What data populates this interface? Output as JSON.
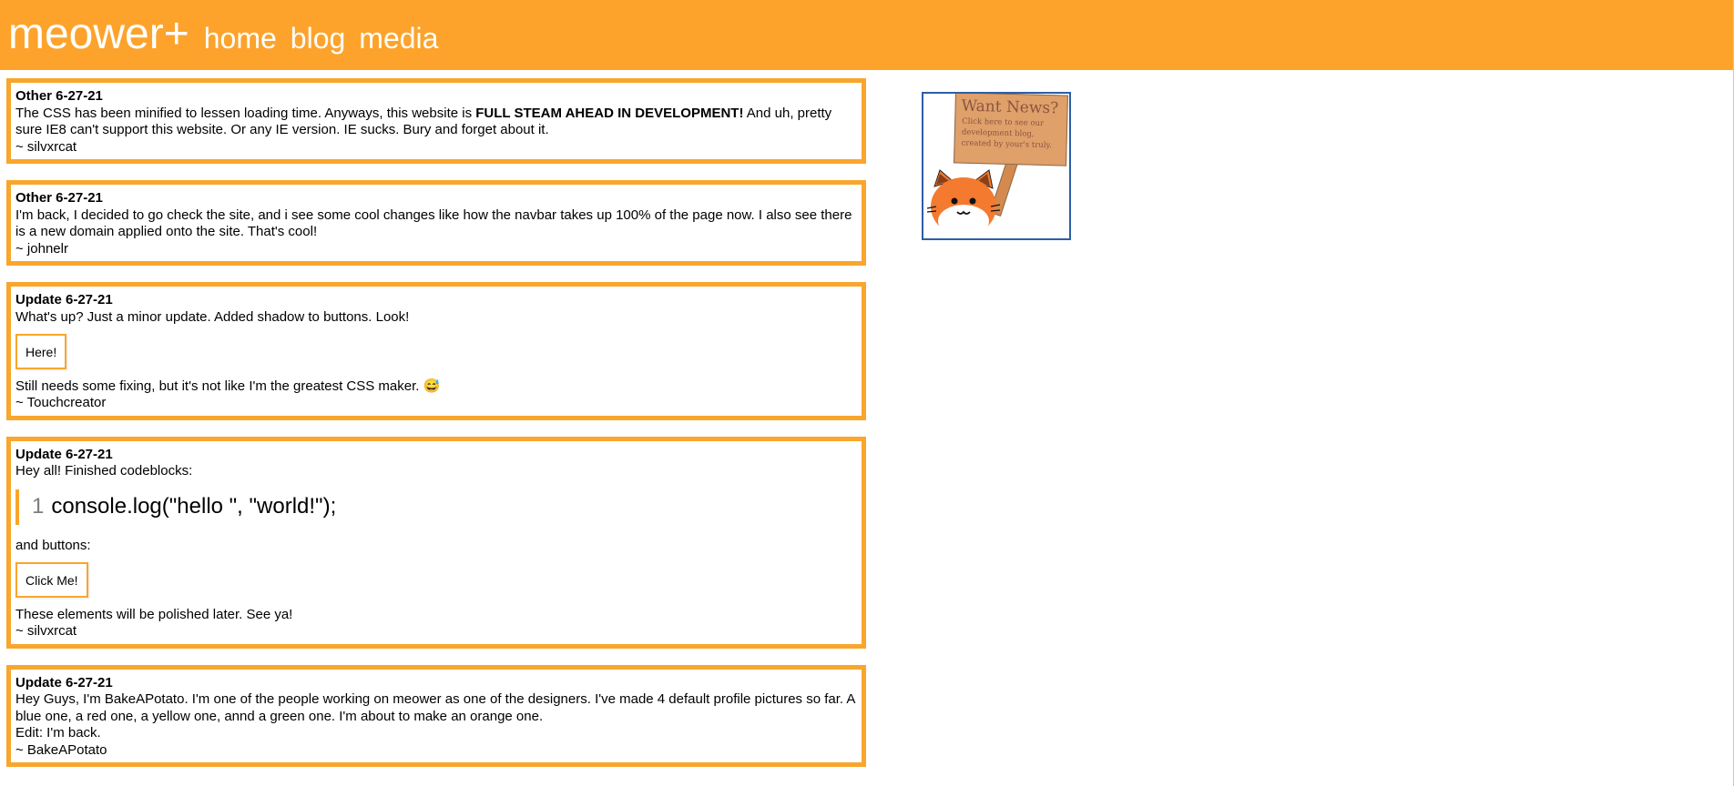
{
  "navbar": {
    "brand": "meower+",
    "links": [
      "home",
      "blog",
      "media"
    ],
    "color": "#fda32b"
  },
  "posts": [
    {
      "title": "Other 6-27-21",
      "text_before_bold": "The CSS has been minified to lessen loading time. Anyways, this website is ",
      "text_bold": "FULL STEAM AHEAD IN DEVELOPMENT!",
      "text_after_bold": " And uh, pretty sure IE8 can't support this website. Or any IE version. IE sucks. Bury and forget about it.",
      "signature": "~ silvxrcat"
    },
    {
      "title": "Other 6-27-21",
      "text": "I'm back, I decided to go check the site, and i see some cool changes like how the navbar takes up 100% of the page now. I also see there is a new domain applied onto the site. That's cool!",
      "signature": "~ johnelr"
    },
    {
      "title": "Update 6-27-21",
      "text": "What's up? Just a minor update. Added shadow to buttons. Look!",
      "button_label": "Here!",
      "text2": "Still needs some fixing, but it's not like I'm the greatest CSS maker. 😅",
      "signature": "~ Touchcreator"
    },
    {
      "title": "Update 6-27-21",
      "text": "Hey all! Finished codeblocks:",
      "code_line_number": "1",
      "code": "console.log(\"hello \", \"world!\");",
      "text2": "and buttons:",
      "button_label": "Click Me!",
      "text3": "These elements will be polished later. See ya!",
      "signature": "~ silvxrcat"
    },
    {
      "title": "Update 6-27-21",
      "text": "Hey Guys, I'm BakeAPotato. I'm one of the people working on meower as one of the designers. I've made 4 default profile pictures so far. A blue one, a red one, a yellow one, annd a green one. I'm about to make an orange one.",
      "text2": "Edit: I'm back.",
      "signature": "~ BakeAPotato"
    }
  ],
  "news_card": {
    "sign_title": "Want News?",
    "sign_subtitle": "Click here to see our development blog, created by your's truly."
  },
  "colors": {
    "accent": "#f9a62c",
    "card_border": "#2c5ea7"
  }
}
